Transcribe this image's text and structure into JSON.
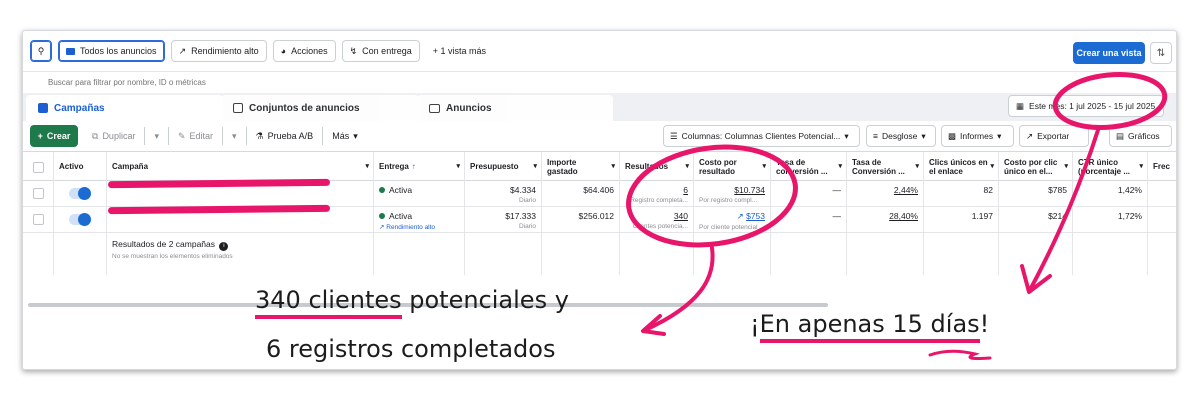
{
  "toolbar": {
    "all_ads": "Todos los anuncios",
    "high_perf": "Rendimiento alto",
    "actions": "Acciones",
    "with_delivery": "Con entrega",
    "more_views": "+  1 vista más",
    "create_view": "Crear una vista"
  },
  "search": {
    "placeholder": "Buscar para filtrar por nombre, ID o métricas"
  },
  "tabs": {
    "campaigns": "Campañas",
    "adsets": "Conjuntos de anuncios",
    "ads": "Anuncios"
  },
  "date_range": "Este mes: 1 jul 2025 - 15 jul 2025",
  "actions_bar": {
    "create": "Crear",
    "duplicate": "Duplicar",
    "edit": "Editar",
    "ab_test": "Prueba A/B",
    "more": "Más",
    "columns": "Columnas: Columnas Clientes Potencial...",
    "breakdown": "Desglose",
    "reports": "Informes",
    "export": "Exportar",
    "charts": "Gráficos"
  },
  "table": {
    "headers": {
      "active": "Activo",
      "campaign": "Campaña",
      "delivery": "Entrega",
      "budget": "Presupuesto",
      "spent": "Importe gastado",
      "results": "Resultados",
      "cost_per_result": "Costo por resultado",
      "conv_rate": "Tasa de conversión ...",
      "conv_rate2": "Tasa de Conversión ...",
      "link_clicks": "Clics únicos en el enlace",
      "cost_per_click": "Costo por clic único en el...",
      "ctr": "CTR único (porcentaje ...",
      "freq": "Frec"
    },
    "rows": [
      {
        "delivery": "Activa",
        "delivery_sub": "",
        "budget": "$4.334",
        "budget_sub": "Diario",
        "spent": "$64.406",
        "results": "6",
        "results_sub": "Registro completa...",
        "cost": "$10.734",
        "cost_sub": "Por registro compl...",
        "conv_rate": "—",
        "conv_rate2": "2,44%",
        "clicks": "82",
        "cpc": "$785",
        "ctr": "1,42%"
      },
      {
        "delivery": "Activa",
        "delivery_sub": "Rendimiento alto",
        "budget": "$17.333",
        "budget_sub": "Diario",
        "spent": "$256.012",
        "results": "340",
        "results_sub": "Clientes potencia...",
        "cost": "$753",
        "cost_sub": "Por cliente potencial",
        "conv_rate": "—",
        "conv_rate2": "28,40%",
        "clicks": "1.197",
        "cpc": "$214",
        "ctr": "1,72%"
      }
    ],
    "summary": {
      "label": "Resultados de 2 campañas",
      "sub": "No se muestran los elementos eliminados"
    }
  },
  "annotations": {
    "left_line1_a": "340 clientes",
    "left_line1_b": " potenciales y",
    "left_line2": "6 registros completados",
    "right_a": "¡",
    "right_b": "En apenas 15 días",
    "right_c": "!"
  },
  "colors": {
    "accent": "#e8166b",
    "primary": "#1b6bd3",
    "green": "#1e7a4a"
  }
}
